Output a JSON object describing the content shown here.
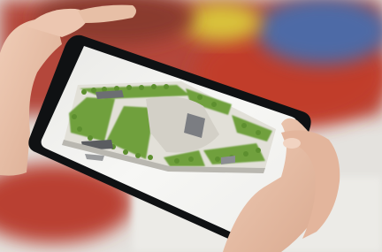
{
  "photo": {
    "subject": "hands-holding-smartphone",
    "screen_content": "3d-site-model",
    "palette": {
      "background_red": "#c6402f",
      "background_blue": "#4d6aa6",
      "background_yellow": "#d9c23b",
      "floor": "#e6e4df",
      "phone_body": "#111315",
      "screen_white": "#f6f6f4",
      "tree_green": "#6fa03c",
      "paving": "#d3d0c7",
      "skin": "#e8c1a9"
    }
  }
}
